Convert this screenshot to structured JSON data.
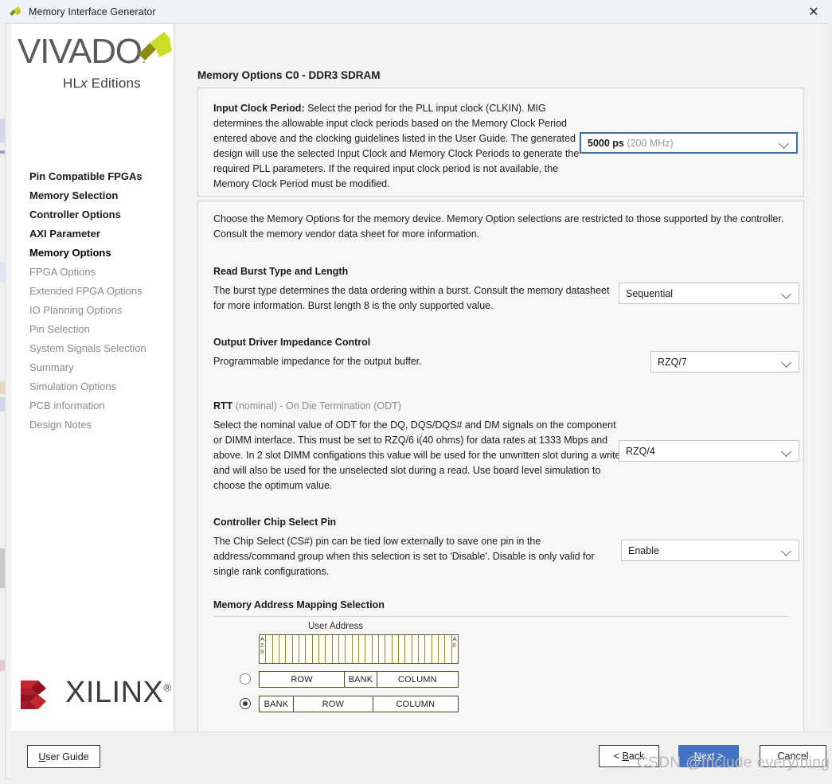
{
  "window": {
    "title": "Memory Interface Generator",
    "app_icon": "vivado-logo-icon",
    "close_label": "✕"
  },
  "sidebar": {
    "brand": {
      "product": "VIVADO",
      "edition_prefix": "HL",
      "edition_italic": "x",
      "edition_suffix": " Editions",
      "vendor": "XILINX",
      "vendor_mark": "®"
    },
    "items": [
      {
        "label": "Pin Compatible FPGAs",
        "state": "enabled"
      },
      {
        "label": "Memory Selection",
        "state": "enabled"
      },
      {
        "label": "Controller Options",
        "state": "enabled"
      },
      {
        "label": "AXI Parameter",
        "state": "enabled"
      },
      {
        "label": "Memory Options",
        "state": "current"
      },
      {
        "label": "FPGA Options",
        "state": "disabled"
      },
      {
        "label": "Extended FPGA Options",
        "state": "disabled"
      },
      {
        "label": "IO Planning Options",
        "state": "disabled"
      },
      {
        "label": "Pin Selection",
        "state": "disabled"
      },
      {
        "label": "System Signals Selection",
        "state": "disabled"
      },
      {
        "label": "Summary",
        "state": "disabled"
      },
      {
        "label": "Simulation Options",
        "state": "disabled"
      },
      {
        "label": "PCB information",
        "state": "disabled"
      },
      {
        "label": "Design Notes",
        "state": "disabled"
      }
    ]
  },
  "main": {
    "page_title": "Memory Options C0 - DDR3 SDRAM",
    "clock_panel": {
      "label_bold": "Input Clock Period:",
      "description": " Select the period for the PLL input clock (CLKIN). MIG determines the allowable input clock periods based on the Memory Clock Period entered above and the clocking guidelines listed in the User Guide. The generated design will use the selected Input Clock and Memory Clock Periods to generate the required PLL parameters. If the required input clock period is not available, the Memory Clock Period must be modified.",
      "dropdown_value": "5000 ps",
      "dropdown_value_muted": "(200 MHz)"
    },
    "intro": "Choose the Memory Options for the memory device. Memory Option selections are restricted to those supported by the controller. Consult the memory vendor data sheet for more information.",
    "sections": [
      {
        "title": "Read Burst Type and Length",
        "description": "The burst type determines the data ordering within a burst. Consult the memory datasheet for more information. Burst length 8 is the only supported value.",
        "dropdown_value": "Sequential"
      },
      {
        "title": "Output Driver Impedance Control",
        "description": "Programmable impedance for the output buffer.",
        "dropdown_value": "RZQ/7"
      },
      {
        "title_bold": "RTT",
        "title_muted": " (nominal) - On Die Termination (ODT)",
        "description": "Select the nominal value of ODT for the DQ, DQS/DQS# and DM signals on the component or DIMM interface. This must be set to RZQ/6 i(40 ohms) for data rates at 1333 Mbps and above. In 2 slot DIMM configations this value will be used for the unwritten slot during a write and will also be used for the unselected slot during a read. Use board level simulation to choose the optimum value.",
        "dropdown_value": "RZQ/4"
      },
      {
        "title": "Controller Chip Select Pin",
        "description": "The Chip Select (CS#) pin can be tied low externally to save one pin in the address/command group when this selection is set to 'Disable'. Disable is only valid for single rank configurations.",
        "dropdown_value": "Enable"
      }
    ],
    "address_mapping": {
      "title": "Memory Address Mapping Selection",
      "user_address_label": "User Address",
      "msb_label": "A29",
      "lsb_label": "A0",
      "bit_count": 30,
      "options": [
        {
          "selected": false,
          "segments": [
            {
              "label": "ROW",
              "weight": 43
            },
            {
              "label": "BANK",
              "weight": 16
            },
            {
              "label": "COLUMN",
              "weight": 41
            }
          ]
        },
        {
          "selected": true,
          "segments": [
            {
              "label": "BANK",
              "weight": 17
            },
            {
              "label": "ROW",
              "weight": 40
            },
            {
              "label": "COLUMN",
              "weight": 43
            }
          ]
        }
      ]
    }
  },
  "footer": {
    "user_guide": {
      "pre": "U",
      "post": "ser Guide"
    },
    "back": {
      "pre": "< ",
      "mnemonic": "B",
      "post": "ack"
    },
    "next": {
      "mnemonic": "N",
      "post": "ext >"
    },
    "cancel": "Cancel"
  },
  "watermark": "CSDN @Include everything",
  "colors": {
    "accent_blue": "#4472c4",
    "focus_blue": "#3b6ea5",
    "brand_green": "#cddb29",
    "brand_olive": "#8a8c12",
    "xilinx_red": "#b01b2e",
    "disabled_gray": "#8a8a8a"
  }
}
